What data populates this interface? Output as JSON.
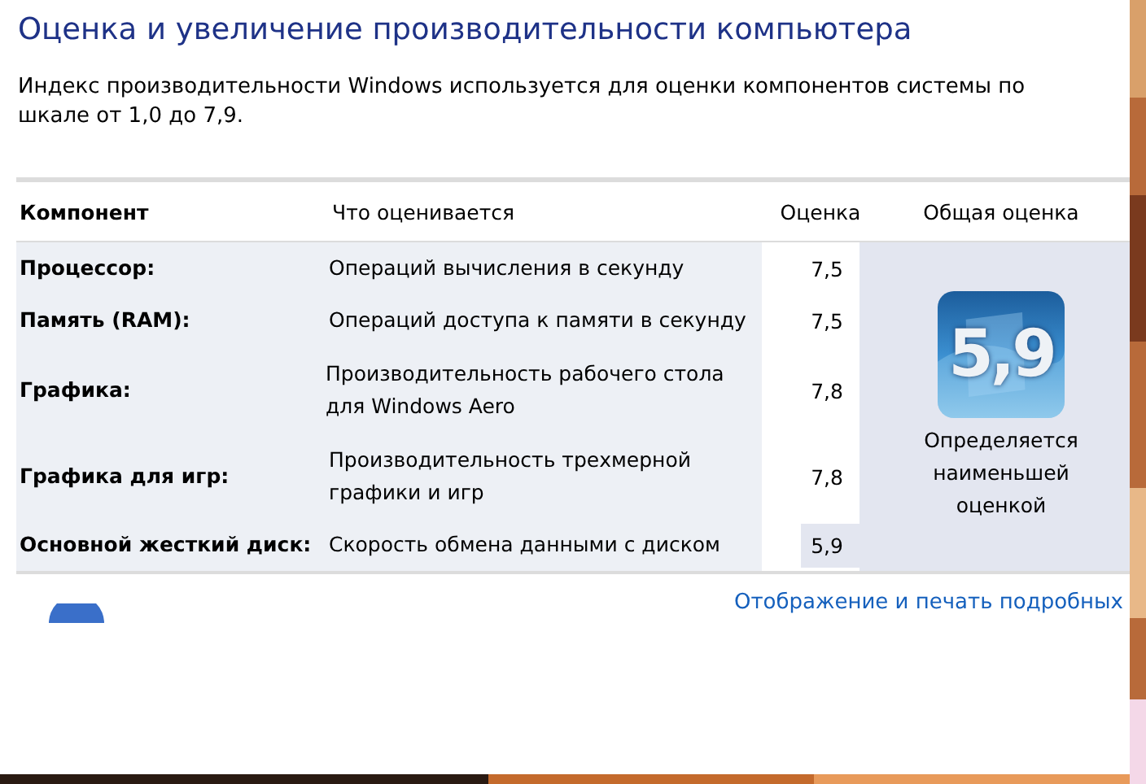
{
  "title": "Оценка и увеличение производительности компьютера",
  "description": "Индекс производительности Windows используется для оценки компонентов системы по шкале от 1,0 до 7,9.",
  "table": {
    "columns": [
      "Компонент",
      "Что оценивается",
      "Оценка",
      "Общая оценка"
    ],
    "rows": [
      {
        "component": "Процессор:",
        "rated": "Операций вычисления в секунду",
        "score": "7,5",
        "lowest": false
      },
      {
        "component": "Память (RAM):",
        "rated": "Операций доступа к памяти в секунду",
        "score": "7,5",
        "lowest": false
      },
      {
        "component": "Графика:",
        "rated": "Производительность рабочего стола для Windows Aero",
        "score": "7,8",
        "lowest": false
      },
      {
        "component": "Графика для игр:",
        "rated": "Производительность трехмерной графики и игр",
        "score": "7,8",
        "lowest": false
      },
      {
        "component": "Основной жесткий диск:",
        "rated": "Скорость обмена данными с диском",
        "score": "5,9",
        "lowest": true
      }
    ],
    "base_score": "5,9",
    "base_note": "Определяется наименьшей оценкой"
  },
  "link": "Отображение и печать подробных"
}
